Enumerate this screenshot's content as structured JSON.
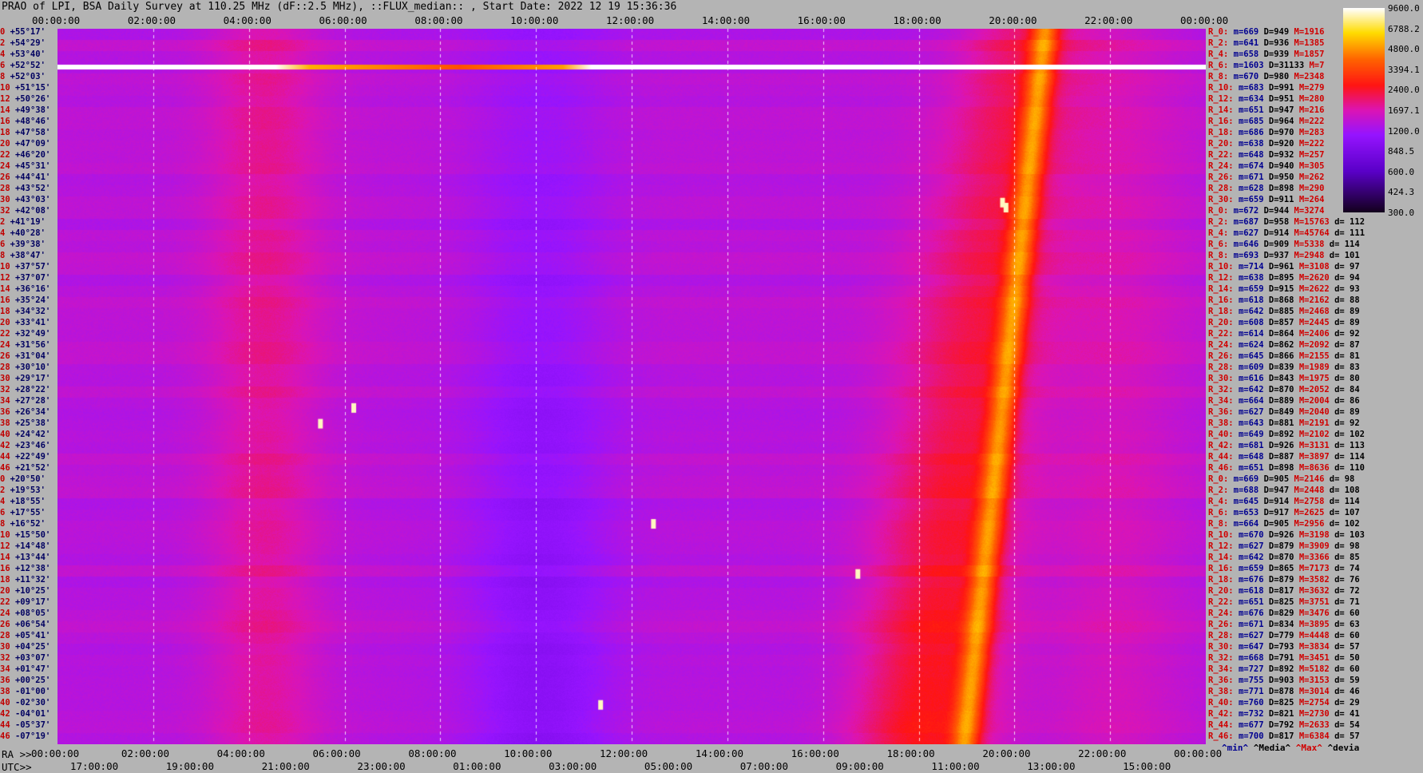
{
  "title": "PRAO of LPI, BSA Daily Survey at 110.25 MHz (dF::2.5 MHz), ::FLUX_median:: , Start Date: 2022 12 19 15:36:36",
  "chart_data": {
    "type": "heatmap",
    "title": "PRAO of LPI, BSA Daily Survey at 110.25 MHz (dF::2.5 MHz), ::FLUX_median:: , Start Date: 2022 12 19 15:36:36",
    "x_top_ticks": [
      "00:00:00",
      "02:00:00",
      "04:00:00",
      "06:00:00",
      "08:00:00",
      "10:00:00",
      "12:00:00",
      "14:00:00",
      "16:00:00",
      "18:00:00",
      "20:00:00",
      "22:00:00",
      "00:00:00"
    ],
    "x_ra_label": "RA >>",
    "x_ra_ticks": [
      "00:00:00",
      "02:00:00",
      "04:00:00",
      "06:00:00",
      "08:00:00",
      "10:00:00",
      "12:00:00",
      "14:00:00",
      "16:00:00",
      "18:00:00",
      "20:00:00",
      "22:00:00",
      "00:00:00"
    ],
    "x_utc_label": "UTC>>",
    "x_utc_ticks": [
      "17:00:00",
      "19:00:00",
      "21:00:00",
      "23:00:00",
      "01:00:00",
      "03:00:00",
      "05:00:00",
      "07:00:00",
      "09:00:00",
      "11:00:00",
      "13:00:00",
      "15:00:00"
    ],
    "colorbar_ticks": [
      "9600.0",
      "6788.2",
      "4800.0",
      "3394.1",
      "2400.0",
      "1697.1",
      "1200.0",
      "848.5",
      "600.0",
      "424.3",
      "300.0"
    ],
    "declinations": [
      {
        "n": "0",
        "d": "+55°17'"
      },
      {
        "n": "2",
        "d": "+54°29'"
      },
      {
        "n": "4",
        "d": "+53°40'"
      },
      {
        "n": "6",
        "d": "+52°52'"
      },
      {
        "n": "8",
        "d": "+52°03'"
      },
      {
        "n": "10",
        "d": "+51°15'"
      },
      {
        "n": "12",
        "d": "+50°26'"
      },
      {
        "n": "14",
        "d": "+49°38'"
      },
      {
        "n": "16",
        "d": "+48°46'"
      },
      {
        "n": "18",
        "d": "+47°58'"
      },
      {
        "n": "20",
        "d": "+47°09'"
      },
      {
        "n": "22",
        "d": "+46°20'"
      },
      {
        "n": "24",
        "d": "+45°31'"
      },
      {
        "n": "26",
        "d": "+44°41'"
      },
      {
        "n": "28",
        "d": "+43°52'"
      },
      {
        "n": "30",
        "d": "+43°03'"
      },
      {
        "n": "32",
        "d": "+42°08'"
      },
      {
        "n": "2",
        "d": "+41°19'"
      },
      {
        "n": "4",
        "d": "+40°28'"
      },
      {
        "n": "6",
        "d": "+39°38'"
      },
      {
        "n": "8",
        "d": "+38°47'"
      },
      {
        "n": "10",
        "d": "+37°57'"
      },
      {
        "n": "12",
        "d": "+37°07'"
      },
      {
        "n": "14",
        "d": "+36°16'"
      },
      {
        "n": "16",
        "d": "+35°24'"
      },
      {
        "n": "18",
        "d": "+34°32'"
      },
      {
        "n": "20",
        "d": "+33°41'"
      },
      {
        "n": "22",
        "d": "+32°49'"
      },
      {
        "n": "24",
        "d": "+31°56'"
      },
      {
        "n": "26",
        "d": "+31°04'"
      },
      {
        "n": "28",
        "d": "+30°10'"
      },
      {
        "n": "30",
        "d": "+29°17'"
      },
      {
        "n": "32",
        "d": "+28°22'"
      },
      {
        "n": "34",
        "d": "+27°28'"
      },
      {
        "n": "36",
        "d": "+26°34'"
      },
      {
        "n": "38",
        "d": "+25°38'"
      },
      {
        "n": "40",
        "d": "+24°42'"
      },
      {
        "n": "42",
        "d": "+23°46'"
      },
      {
        "n": "44",
        "d": "+22°49'"
      },
      {
        "n": "46",
        "d": "+21°52'"
      },
      {
        "n": "0",
        "d": "+20°50'"
      },
      {
        "n": "2",
        "d": "+19°53'"
      },
      {
        "n": "4",
        "d": "+18°55'"
      },
      {
        "n": "6",
        "d": "+17°55'"
      },
      {
        "n": "8",
        "d": "+16°52'"
      },
      {
        "n": "10",
        "d": "+15°50'"
      },
      {
        "n": "12",
        "d": "+14°48'"
      },
      {
        "n": "14",
        "d": "+13°44'"
      },
      {
        "n": "16",
        "d": "+12°38'"
      },
      {
        "n": "18",
        "d": "+11°32'"
      },
      {
        "n": "20",
        "d": "+10°25'"
      },
      {
        "n": "22",
        "d": "+09°17'"
      },
      {
        "n": "24",
        "d": "+08°05'"
      },
      {
        "n": "26",
        "d": "+06°54'"
      },
      {
        "n": "28",
        "d": "+05°41'"
      },
      {
        "n": "30",
        "d": "+04°25'"
      },
      {
        "n": "32",
        "d": "+03°07'"
      },
      {
        "n": "34",
        "d": "+01°47'"
      },
      {
        "n": "36",
        "d": "+00°25'"
      },
      {
        "n": "38",
        "d": "-01°00'"
      },
      {
        "n": "40",
        "d": "-02°30'"
      },
      {
        "n": "42",
        "d": "-04°01'"
      },
      {
        "n": "44",
        "d": "-05°37'"
      },
      {
        "n": "46",
        "d": "-07°19'"
      }
    ],
    "stats": [
      {
        "r": "R_0:",
        "m": "m=669",
        "D": "D=949",
        "M": "M=1916",
        "d": ""
      },
      {
        "r": "R_2:",
        "m": "m=641",
        "D": "D=936",
        "M": "M=1385",
        "d": ""
      },
      {
        "r": "R_4:",
        "m": "m=658",
        "D": "D=939",
        "M": "M=1857",
        "d": ""
      },
      {
        "r": "R_6:",
        "m": "m=1603",
        "D": "D=31133",
        "M": "M=7",
        "d": ""
      },
      {
        "r": "R_8:",
        "m": "m=670",
        "D": "D=980",
        "M": "M=2348",
        "d": ""
      },
      {
        "r": "R_10:",
        "m": "m=683",
        "D": "D=991",
        "M": "M=279",
        "d": ""
      },
      {
        "r": "R_12:",
        "m": "m=634",
        "D": "D=951",
        "M": "M=280",
        "d": ""
      },
      {
        "r": "R_14:",
        "m": "m=651",
        "D": "D=947",
        "M": "M=216",
        "d": ""
      },
      {
        "r": "R_16:",
        "m": "m=685",
        "D": "D=964",
        "M": "M=222",
        "d": ""
      },
      {
        "r": "R_18:",
        "m": "m=686",
        "D": "D=970",
        "M": "M=283",
        "d": ""
      },
      {
        "r": "R_20:",
        "m": "m=638",
        "D": "D=920",
        "M": "M=222",
        "d": ""
      },
      {
        "r": "R_22:",
        "m": "m=648",
        "D": "D=932",
        "M": "M=257",
        "d": ""
      },
      {
        "r": "R_24:",
        "m": "m=674",
        "D": "D=940",
        "M": "M=305",
        "d": ""
      },
      {
        "r": "R_26:",
        "m": "m=671",
        "D": "D=950",
        "M": "M=262",
        "d": ""
      },
      {
        "r": "R_28:",
        "m": "m=628",
        "D": "D=898",
        "M": "M=290",
        "d": ""
      },
      {
        "r": "R_30:",
        "m": "m=659",
        "D": "D=911",
        "M": "M=264",
        "d": ""
      },
      {
        "r": "R_0:",
        "m": "m=672",
        "D": "D=944",
        "M": "M=3274",
        "d": ""
      },
      {
        "r": "R_2:",
        "m": "m=687",
        "D": "D=958",
        "M": "M=15763",
        "d": "d= 112"
      },
      {
        "r": "R_4:",
        "m": "m=627",
        "D": "D=914",
        "M": "M=45764",
        "d": "d= 111"
      },
      {
        "r": "R_6:",
        "m": "m=646",
        "D": "D=909",
        "M": "M=5338",
        "d": "d= 114"
      },
      {
        "r": "R_8:",
        "m": "m=693",
        "D": "D=937",
        "M": "M=2948",
        "d": "d= 101"
      },
      {
        "r": "R_10:",
        "m": "m=714",
        "D": "D=961",
        "M": "M=3108",
        "d": "d= 97"
      },
      {
        "r": "R_12:",
        "m": "m=638",
        "D": "D=895",
        "M": "M=2620",
        "d": "d= 94"
      },
      {
        "r": "R_14:",
        "m": "m=659",
        "D": "D=915",
        "M": "M=2622",
        "d": "d= 93"
      },
      {
        "r": "R_16:",
        "m": "m=618",
        "D": "D=868",
        "M": "M=2162",
        "d": "d= 88"
      },
      {
        "r": "R_18:",
        "m": "m=642",
        "D": "D=885",
        "M": "M=2468",
        "d": "d= 89"
      },
      {
        "r": "R_20:",
        "m": "m=608",
        "D": "D=857",
        "M": "M=2445",
        "d": "d= 89"
      },
      {
        "r": "R_22:",
        "m": "m=614",
        "D": "D=864",
        "M": "M=2406",
        "d": "d= 92"
      },
      {
        "r": "R_24:",
        "m": "m=624",
        "D": "D=862",
        "M": "M=2092",
        "d": "d= 87"
      },
      {
        "r": "R_26:",
        "m": "m=645",
        "D": "D=866",
        "M": "M=2155",
        "d": "d= 81"
      },
      {
        "r": "R_28:",
        "m": "m=609",
        "D": "D=839",
        "M": "M=1989",
        "d": "d= 83"
      },
      {
        "r": "R_30:",
        "m": "m=616",
        "D": "D=843",
        "M": "M=1975",
        "d": "d= 80"
      },
      {
        "r": "R_32:",
        "m": "m=642",
        "D": "D=870",
        "M": "M=2052",
        "d": "d= 84"
      },
      {
        "r": "R_34:",
        "m": "m=664",
        "D": "D=889",
        "M": "M=2004",
        "d": "d= 86"
      },
      {
        "r": "R_36:",
        "m": "m=627",
        "D": "D=849",
        "M": "M=2040",
        "d": "d= 89"
      },
      {
        "r": "R_38:",
        "m": "m=643",
        "D": "D=881",
        "M": "M=2191",
        "d": "d= 92"
      },
      {
        "r": "R_40:",
        "m": "m=649",
        "D": "D=892",
        "M": "M=2102",
        "d": "d= 102"
      },
      {
        "r": "R_42:",
        "m": "m=681",
        "D": "D=926",
        "M": "M=3131",
        "d": "d= 113"
      },
      {
        "r": "R_44:",
        "m": "m=648",
        "D": "D=887",
        "M": "M=3897",
        "d": "d= 114"
      },
      {
        "r": "R_46:",
        "m": "m=651",
        "D": "D=898",
        "M": "M=8636",
        "d": "d= 110"
      },
      {
        "r": "R_0:",
        "m": "m=669",
        "D": "D=905",
        "M": "M=2146",
        "d": "d= 98"
      },
      {
        "r": "R_2:",
        "m": "m=688",
        "D": "D=947",
        "M": "M=2448",
        "d": "d= 108"
      },
      {
        "r": "R_4:",
        "m": "m=645",
        "D": "D=914",
        "M": "M=2758",
        "d": "d= 114"
      },
      {
        "r": "R_6:",
        "m": "m=653",
        "D": "D=917",
        "M": "M=2625",
        "d": "d= 107"
      },
      {
        "r": "R_8:",
        "m": "m=664",
        "D": "D=905",
        "M": "M=2956",
        "d": "d= 102"
      },
      {
        "r": "R_10:",
        "m": "m=670",
        "D": "D=926",
        "M": "M=3198",
        "d": "d= 103"
      },
      {
        "r": "R_12:",
        "m": "m=627",
        "D": "D=879",
        "M": "M=3909",
        "d": "d= 98"
      },
      {
        "r": "R_14:",
        "m": "m=642",
        "D": "D=870",
        "M": "M=3366",
        "d": "d= 85"
      },
      {
        "r": "R_16:",
        "m": "m=659",
        "D": "D=865",
        "M": "M=7173",
        "d": "d= 74"
      },
      {
        "r": "R_18:",
        "m": "m=676",
        "D": "D=879",
        "M": "M=3582",
        "d": "d= 76"
      },
      {
        "r": "R_20:",
        "m": "m=618",
        "D": "D=817",
        "M": "M=3632",
        "d": "d= 72"
      },
      {
        "r": "R_22:",
        "m": "m=651",
        "D": "D=825",
        "M": "M=3751",
        "d": "d= 71"
      },
      {
        "r": "R_24:",
        "m": "m=676",
        "D": "D=829",
        "M": "M=3476",
        "d": "d= 60"
      },
      {
        "r": "R_26:",
        "m": "m=671",
        "D": "D=834",
        "M": "M=3895",
        "d": "d= 63"
      },
      {
        "r": "R_28:",
        "m": "m=627",
        "D": "D=779",
        "M": "M=4448",
        "d": "d= 60"
      },
      {
        "r": "R_30:",
        "m": "m=647",
        "D": "D=793",
        "M": "M=3834",
        "d": "d= 57"
      },
      {
        "r": "R_32:",
        "m": "m=668",
        "D": "D=791",
        "M": "M=3451",
        "d": "d= 50"
      },
      {
        "r": "R_34:",
        "m": "m=727",
        "D": "D=892",
        "M": "M=5182",
        "d": "d= 60"
      },
      {
        "r": "R_36:",
        "m": "m=755",
        "D": "D=903",
        "M": "M=3153",
        "d": "d= 59"
      },
      {
        "r": "R_38:",
        "m": "m=771",
        "D": "D=878",
        "M": "M=3014",
        "d": "d= 46"
      },
      {
        "r": "R_40:",
        "m": "m=760",
        "D": "D=825",
        "M": "M=2754",
        "d": "d= 29"
      },
      {
        "r": "R_42:",
        "m": "m=732",
        "D": "D=821",
        "M": "M=2730",
        "d": "d= 41"
      },
      {
        "r": "R_44:",
        "m": "m=677",
        "D": "D=792",
        "M": "M=2633",
        "d": "d= 54"
      },
      {
        "r": "R_46:",
        "m": "m=700",
        "D": "D=817",
        "M": "M=6384",
        "d": "d= 57"
      }
    ],
    "legend": {
      "min": "^min^",
      "media": "^Media^",
      "max": "^Max^",
      "devia": "^devia"
    },
    "colors": {
      "low": "#1a0030",
      "mid": "#7a00ff",
      "high": "#ff2a00",
      "peak": "#ffffff",
      "bg": "#b4b4b4"
    }
  }
}
